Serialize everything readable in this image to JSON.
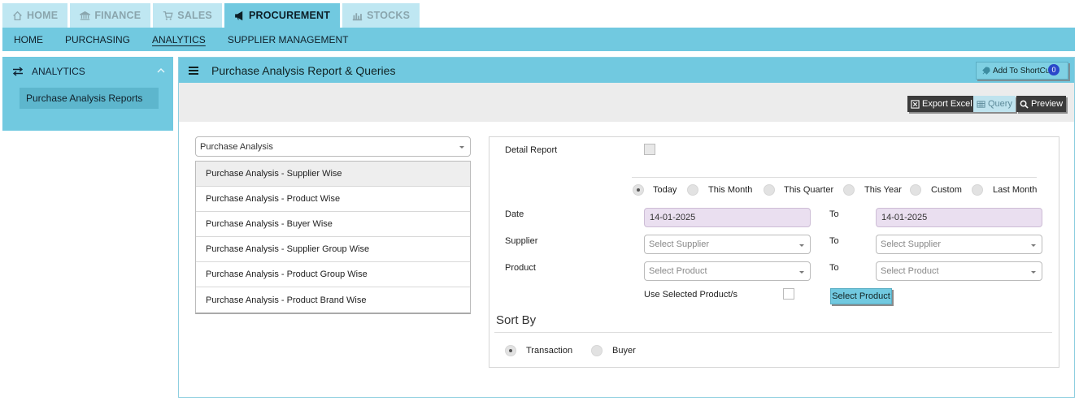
{
  "top_tabs": [
    {
      "label": "HOME",
      "icon": "home-icon"
    },
    {
      "label": "FINANCE",
      "icon": "bank-icon"
    },
    {
      "label": "SALES",
      "icon": "cart-icon"
    },
    {
      "label": "PROCUREMENT",
      "icon": "megaphone-icon",
      "active": true
    },
    {
      "label": "STOCKS",
      "icon": "bar-chart-icon"
    }
  ],
  "sub_nav": [
    {
      "label": "HOME"
    },
    {
      "label": "PURCHASING"
    },
    {
      "label": "ANALYTICS",
      "active": true
    },
    {
      "label": "SUPPLIER MANAGEMENT"
    }
  ],
  "sidebar": {
    "title": "ANALYTICS",
    "items": [
      {
        "label": "Purchase Analysis Reports"
      }
    ]
  },
  "main": {
    "title": "Purchase Analysis Report & Queries",
    "shortcut_label": "Add To ShortCut",
    "shortcut_count": "0",
    "toolbar": {
      "export_label": "Export Excel",
      "query_label": "Query",
      "preview_label": "Preview"
    }
  },
  "report": {
    "selected": "Purchase Analysis",
    "options": [
      "Purchase Analysis - Supplier Wise",
      "Purchase Analysis - Product Wise",
      "Purchase Analysis - Buyer Wise",
      "Purchase Analysis - Supplier Group Wise",
      "Purchase Analysis - Product Group Wise",
      "Purchase Analysis - Product Brand Wise"
    ]
  },
  "form": {
    "detail_report_label": "Detail Report",
    "periods": [
      {
        "label": "Today",
        "checked": true
      },
      {
        "label": "This Month"
      },
      {
        "label": "This Quarter"
      },
      {
        "label": "This Year"
      },
      {
        "label": "Custom"
      },
      {
        "label": "Last Month"
      }
    ],
    "date_label": "Date",
    "date_from": "14-01-2025",
    "date_to": "14-01-2025",
    "to_label": "To",
    "supplier_label": "Supplier",
    "supplier_placeholder": "Select Supplier",
    "product_label": "Product",
    "product_placeholder": "Select Product",
    "use_selected_label": "Use Selected Product/s",
    "select_product_button": "Select Product",
    "sort_by_title": "Sort By",
    "sort_options": [
      {
        "label": "Transaction",
        "checked": true
      },
      {
        "label": "Buyer"
      }
    ]
  },
  "colors": {
    "accent": "#71c9e0",
    "accent_light": "#bfe7f2",
    "dark_button": "#3b3b3b",
    "date_bg": "#eadff0"
  }
}
